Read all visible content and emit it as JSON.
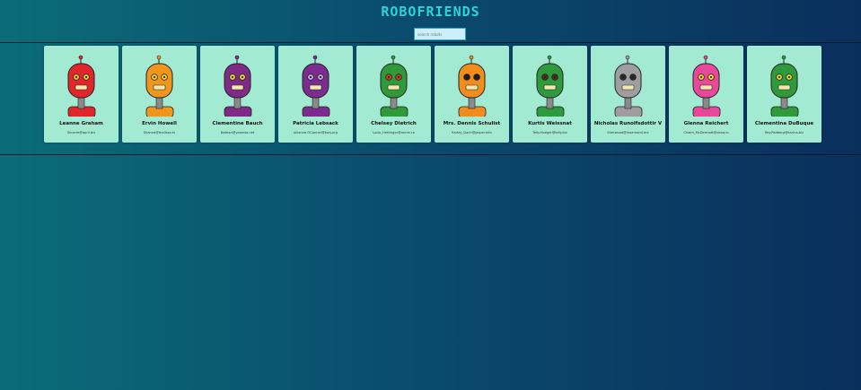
{
  "header": {
    "title": "ROBOFRIENDS"
  },
  "search": {
    "placeholder": "search robots",
    "value": ""
  },
  "robots": [
    {
      "name": "Leanne Graham",
      "email": "Sincere@april.biz",
      "body_color": "#e0262a",
      "eye": "#e7c61d"
    },
    {
      "name": "Ervin Howell",
      "email": "Shanna@melissa.tv",
      "body_color": "#f0961c",
      "eye": "#f5d31a"
    },
    {
      "name": "Clementine Bauch",
      "email": "Nathan@yesenia.net",
      "body_color": "#7e2a86",
      "eye": "#e2d51d"
    },
    {
      "name": "Patricia Lebsack",
      "email": "Julianne.OConner@kory.org",
      "body_color": "#7b2d8f",
      "eye": "#c9a1d9"
    },
    {
      "name": "Chelsey Dietrich",
      "email": "Lucio_Hettinger@annie.ca",
      "body_color": "#2f9a3a",
      "eye": "#d23b2a"
    },
    {
      "name": "Mrs. Dennis Schulist",
      "email": "Karley_Dach@jasper.info",
      "body_color": "#f08d1c",
      "eye": "#1c1c1c"
    },
    {
      "name": "Kurtis Weissnat",
      "email": "Telly.Hoeger@billy.biz",
      "body_color": "#2d9a3d",
      "eye": "#5a2a1f"
    },
    {
      "name": "Nicholas Runolfsdottir V",
      "email": "Sherwood@rosamond.me",
      "body_color": "#9e9ea0",
      "eye": "#2a2a2a"
    },
    {
      "name": "Glenna Reichert",
      "email": "Chaim_McDermott@dana.io",
      "body_color": "#e8489a",
      "eye": "#f0d51a"
    },
    {
      "name": "Clementina DuBuque",
      "email": "Rey.Padberg@karina.biz",
      "body_color": "#2e9a3b",
      "eye": "#e8d41c"
    }
  ]
}
